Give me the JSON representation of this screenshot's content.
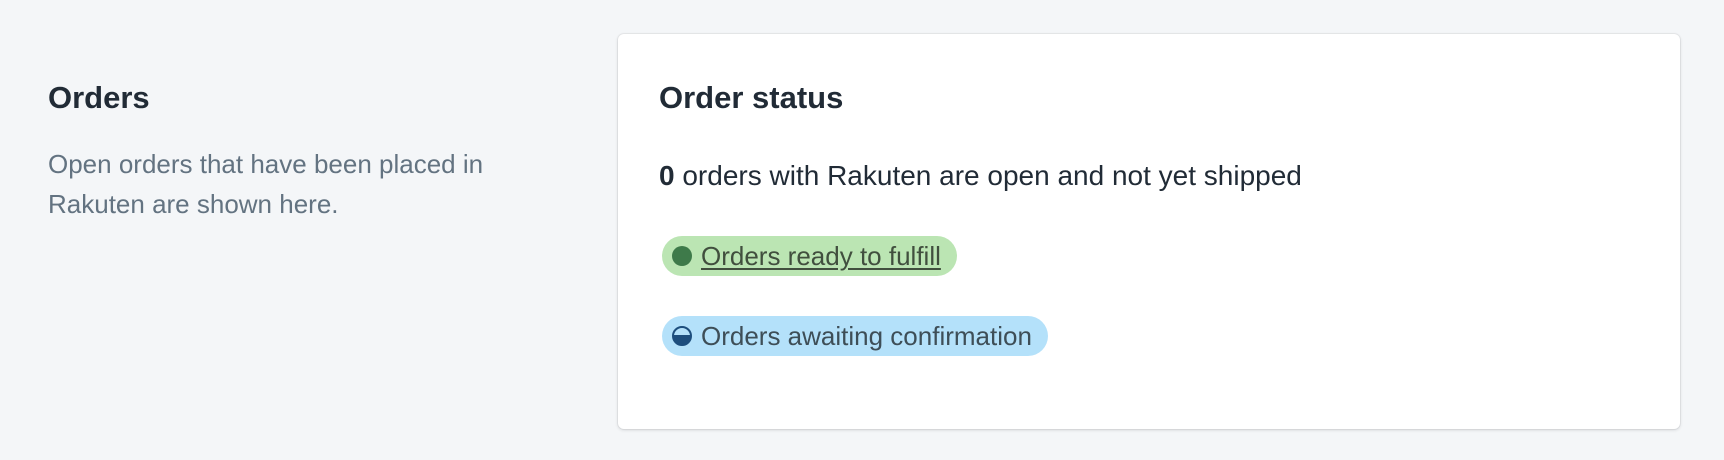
{
  "annotation": {
    "title": "Orders",
    "description": "Open orders that have been placed in Rakuten are shown here."
  },
  "order_status": {
    "title": "Order status",
    "open_count": "0",
    "summary_text": " orders with Rakuten are open and not yet shipped",
    "badges": [
      {
        "label": "Orders ready to fulfill",
        "status": "success",
        "progress": "complete",
        "color": "#bbe5b3"
      },
      {
        "label": "Orders awaiting confirmation",
        "status": "info",
        "progress": "partial",
        "color": "#b4e1fa"
      }
    ]
  },
  "colors": {
    "page_background": "#f4f6f8",
    "card_background": "#ffffff",
    "text_primary": "#212b36",
    "text_subdued": "#637381"
  }
}
